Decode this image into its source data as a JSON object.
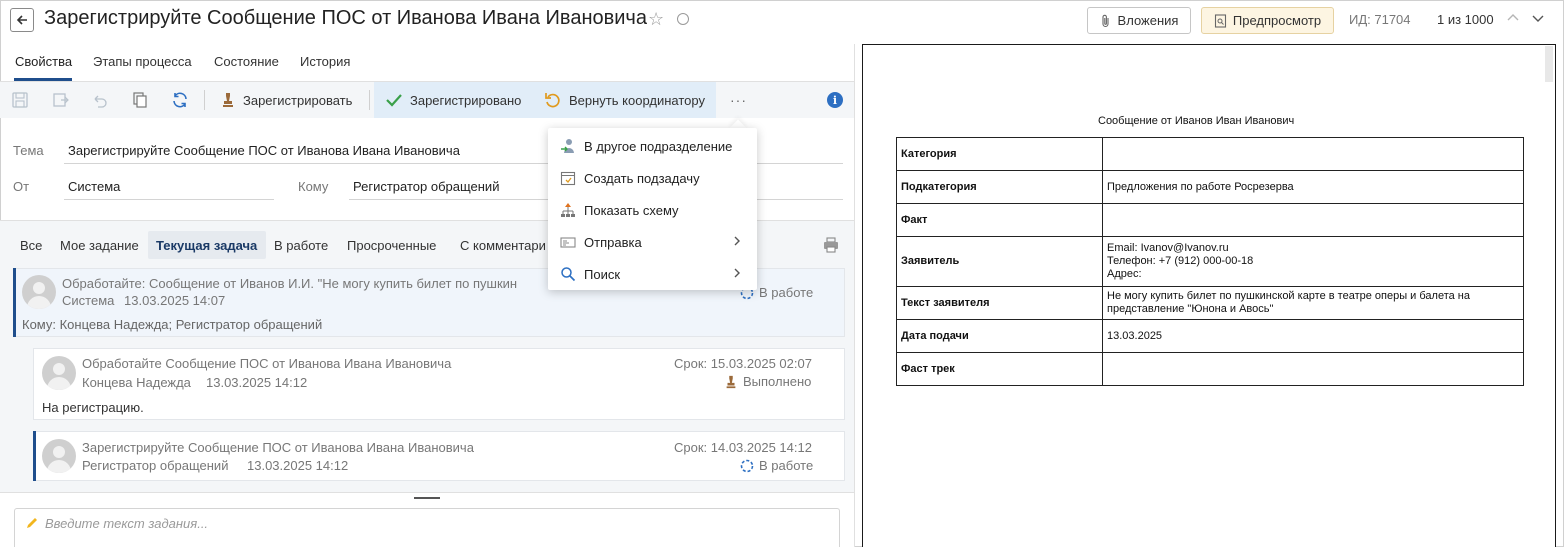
{
  "header": {
    "title": "Зарегистрируйте Сообщение ПОС от Иванова Ивана Ивановича",
    "attachments_label": "Вложения",
    "preview_label": "Предпросмотр",
    "id_label": "ИД: 71704",
    "counter": "1 из 1000"
  },
  "tabs": [
    "Свойства",
    "Этапы процесса",
    "Состояние",
    "История"
  ],
  "toolbar": {
    "register_label": "Зарегистрировать",
    "registered_label": "Зарегистрировано",
    "return_label": "Вернуть координатору",
    "more_label": "···"
  },
  "form": {
    "subject_label": "Тема",
    "subject_value": "Зарегистрируйте Сообщение  ПОС от Иванова Ивана Ивановича",
    "from_label": "От",
    "from_value": "Система",
    "to_label": "Кому",
    "to_value": "Регистратор обращений"
  },
  "filters": [
    "Все",
    "Мое задание",
    "Текущая задача",
    "В работе",
    "Просроченные",
    "С комментари"
  ],
  "tasks": [
    {
      "title": "Обработайте: Сообщение от Иванов И.И. \"Не могу купить билет по пушкин",
      "author": "Система",
      "date": "13.03.2025 14:07",
      "status": "В работе",
      "recipients": "Кому: Концева Надежда; Регистратор обращений"
    },
    {
      "title": "Обработайте Сообщение ПОС от Иванова Ивана Ивановича",
      "author": "Концева Надежда",
      "date": "13.03.2025 14:12",
      "deadline": "Срок: 15.03.2025 02:07",
      "status": "Выполнено",
      "comment": "На регистрацию."
    },
    {
      "title": "Зарегистрируйте Сообщение ПОС от Иванова Ивана Ивановича",
      "author": "Регистратор обращений",
      "date": "13.03.2025 14:12",
      "deadline": "Срок: 14.03.2025 14:12",
      "status": "В работе"
    }
  ],
  "input": {
    "placeholder": "Введите текст задания..."
  },
  "dropdown": {
    "items": [
      {
        "label": "В другое подразделение",
        "icon": "user-transfer-icon"
      },
      {
        "label": "Создать подзадачу",
        "icon": "subtask-icon"
      },
      {
        "label": "Показать схему",
        "icon": "scheme-icon"
      },
      {
        "label": "Отправка",
        "icon": "send-icon",
        "submenu": true
      },
      {
        "label": "Поиск",
        "icon": "search-icon",
        "submenu": true
      }
    ]
  },
  "document": {
    "title": "Сообщение от Иванов Иван Иванович",
    "rows": [
      {
        "key": "Категория",
        "value": ""
      },
      {
        "key": "Подкатегория",
        "value": "Предложения по работе Росрезерва"
      },
      {
        "key": "Факт",
        "value": ""
      },
      {
        "key": "Заявитель",
        "value": "Email: Ivanov@Ivanov.ru\nТелефон: +7 (912) 000-00-18\nАдрес:"
      },
      {
        "key": "Текст заявителя",
        "value": "Не могу купить билет по пушкинской карте в театре оперы и балета на представление \"Юнона и Авось\""
      },
      {
        "key": "Дата подачи",
        "value": "13.03.2025"
      },
      {
        "key": "Фаст трек",
        "value": ""
      }
    ]
  },
  "colors": {
    "accent": "#1f4e8c",
    "toolbar_bg": "#f4f6f8",
    "highlight_bg": "#e1edf8",
    "preview_btn_bg": "#fdf5e2",
    "check_green": "#3aa04a",
    "return_orange": "#e09a1e"
  }
}
